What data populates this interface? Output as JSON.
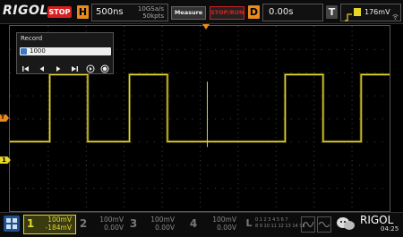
{
  "brand": {
    "logo": "RIGOL",
    "status": "STOP"
  },
  "horizontal": {
    "key": "H",
    "timebase": "500ns",
    "sample_rate": "10GSa/s",
    "mem_depth": "50kpts"
  },
  "toolbar": {
    "measure": "Measure",
    "stop_run": "STOP/RUN"
  },
  "delay": {
    "key": "D",
    "value": "0.00s"
  },
  "trigger": {
    "key": "T",
    "level": "176mV"
  },
  "record": {
    "title": "Record",
    "frame_value": "1000",
    "buttons": [
      "skip-start",
      "step-back",
      "play",
      "step-forward",
      "rec",
      "stop"
    ]
  },
  "markers": {
    "ch1": "1",
    "trigger": "T"
  },
  "channels": [
    {
      "num": "1",
      "scale": "100mV",
      "offset": "-184mV",
      "color": "#e6d628",
      "active": true
    },
    {
      "num": "2",
      "scale": "100mV",
      "offset": "0.00V",
      "color": "#777777",
      "active": false
    },
    {
      "num": "3",
      "scale": "100mV",
      "offset": "0.00V",
      "color": "#777777",
      "active": false
    },
    {
      "num": "4",
      "scale": "100mV",
      "offset": "0.00V",
      "color": "#777777",
      "active": false
    }
  ],
  "logic": {
    "key": "L",
    "row1": "0 1 2 3 4 5 6 7",
    "row2": "8 9 10 11 12 13 14 15"
  },
  "status_right": {
    "time": "04:25",
    "watermark": "RIGOL"
  },
  "waveform": {
    "color": "#e6d628",
    "low_level_div": -1,
    "high_level_div": 1.9,
    "period": "2.0 div",
    "edges": [
      {
        "rise": 1.05,
        "fall": 2.05
      },
      {
        "rise": 3.15,
        "fall": 4.15
      },
      {
        "rise": 7.25,
        "fall": 8.25
      },
      {
        "rise": 9.25,
        "fall": 10.0
      }
    ]
  }
}
